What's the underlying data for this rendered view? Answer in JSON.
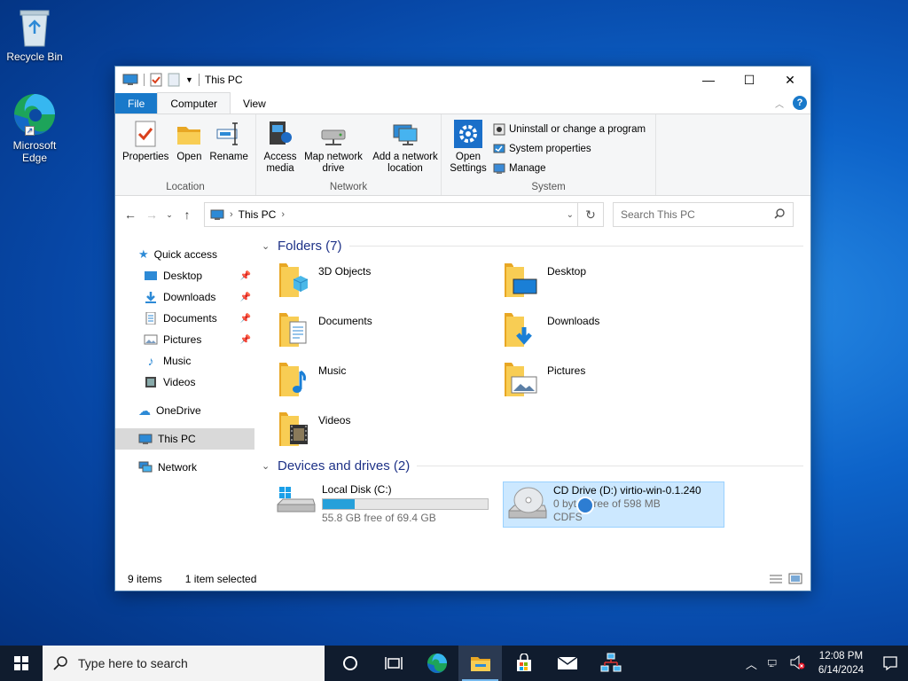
{
  "desktop": {
    "icons": [
      {
        "label": "Recycle Bin"
      },
      {
        "label": "Microsoft Edge"
      }
    ]
  },
  "window": {
    "title": "This PC",
    "tabs": {
      "file": "File",
      "computer": "Computer",
      "view": "View"
    },
    "ribbon": {
      "location": {
        "label": "Location",
        "properties": "Properties",
        "open": "Open",
        "rename": "Rename"
      },
      "network": {
        "label": "Network",
        "access_media": "Access media",
        "map_network_drive": "Map network drive",
        "add_network_location": "Add a network location"
      },
      "system": {
        "label": "System",
        "open_settings": "Open Settings",
        "uninstall": "Uninstall or change a program",
        "system_properties": "System properties",
        "manage": "Manage"
      }
    },
    "address": {
      "path": "This PC",
      "search_placeholder": "Search This PC"
    },
    "navpane": {
      "quick_access": "Quick access",
      "quick_items": [
        "Desktop",
        "Downloads",
        "Documents",
        "Pictures",
        "Music",
        "Videos"
      ],
      "onedrive": "OneDrive",
      "this_pc": "This PC",
      "network": "Network"
    },
    "folders_header": "Folders (7)",
    "folders": [
      "3D Objects",
      "Desktop",
      "Documents",
      "Downloads",
      "Music",
      "Pictures",
      "Videos"
    ],
    "drives_header": "Devices and drives (2)",
    "drives": [
      {
        "name": "Local Disk (C:)",
        "free": "55.8 GB free of 69.4 GB",
        "used_fraction": 0.196
      },
      {
        "name": "CD Drive (D:) virtio-win-0.1.240",
        "free": "0 bytes free of 598 MB",
        "fs": "CDFS"
      }
    ],
    "status": {
      "items": "9 items",
      "selected": "1 item selected"
    }
  },
  "taskbar": {
    "search_placeholder": "Type here to search",
    "time": "12:08 PM",
    "date": "6/14/2024"
  }
}
